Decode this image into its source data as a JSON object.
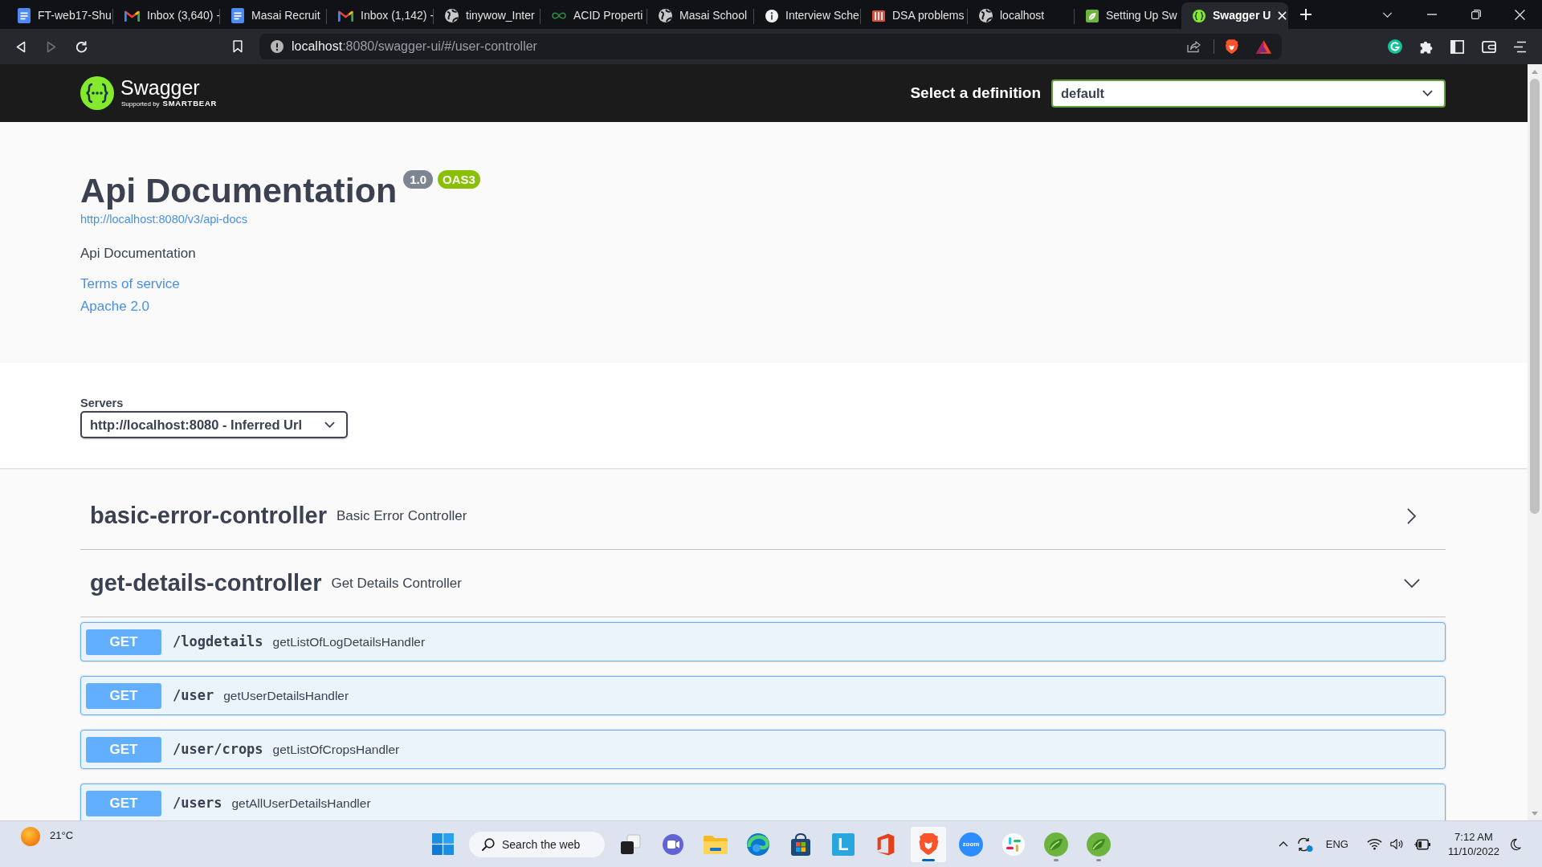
{
  "browser": {
    "tabs": [
      {
        "kind": "document",
        "title": "FT-web17-Shu",
        "selected": false
      },
      {
        "kind": "mail",
        "title": "Inbox (3,640) -",
        "selected": false
      },
      {
        "kind": "document",
        "title": "Masai Recruit",
        "selected": false
      },
      {
        "kind": "mail",
        "title": "Inbox (1,142) -",
        "selected": false
      },
      {
        "kind": "globe",
        "title": "tinywow_Inter",
        "selected": false
      },
      {
        "kind": "infinity",
        "title": "ACID Properti",
        "selected": false
      },
      {
        "kind": "globe",
        "title": "Masai School",
        "selected": false
      },
      {
        "kind": "info",
        "title": "Interview Sche",
        "selected": false
      },
      {
        "kind": "stripes",
        "title": "DSA problems",
        "selected": false
      },
      {
        "kind": "globe",
        "title": "localhost",
        "selected": false
      },
      {
        "kind": "leaf",
        "title": "Setting Up Sw",
        "selected": false
      },
      {
        "kind": "braces",
        "title": "Swagger U",
        "selected": true
      }
    ],
    "nav_buttons": [
      {
        "kind": "back",
        "disabled": false
      },
      {
        "kind": "forward",
        "disabled": true
      },
      {
        "kind": "reload",
        "disabled": false
      }
    ],
    "address_bar": {
      "host": "localhost",
      "path": ":8080/swagger-ui/#/user-controller"
    }
  },
  "swagger": {
    "header": {
      "logo_name": "Swagger",
      "logo_tagline": "Supported by",
      "logo_brand": "SMARTBEAR",
      "definition_label": "Select a definition",
      "definition_value": "default"
    },
    "info": {
      "title": "Api Documentation",
      "version": "1.0",
      "spec_version": "OAS3",
      "spec_url": "http://localhost:8080/v3/api-docs",
      "description": "Api Documentation",
      "links": [
        "Terms of service",
        "Apache 2.0"
      ]
    },
    "servers": {
      "label": "Servers",
      "selected_server": "http://localhost:8080 - Inferred Url"
    },
    "tags": [
      {
        "name": "basic-error-controller",
        "description": "Basic Error Controller",
        "expanded": false
      },
      {
        "name": "get-details-controller",
        "description": "Get Details Controller",
        "expanded": true,
        "operations": [
          {
            "method": "GET",
            "path": "/logdetails",
            "summary": "getListOfLogDetailsHandler"
          },
          {
            "method": "GET",
            "path": "/user",
            "summary": "getUserDetailsHandler"
          },
          {
            "method": "GET",
            "path": "/user/crops",
            "summary": "getListOfCropsHandler"
          },
          {
            "method": "GET",
            "path": "/users",
            "summary": "getAllUserDetailsHandler"
          }
        ]
      }
    ]
  },
  "taskbar": {
    "weather": "21°C",
    "search": {
      "placeholder": "Search the web"
    },
    "apps": [
      {
        "kind": "task-view",
        "selected": false,
        "running": false
      },
      {
        "kind": "chat",
        "selected": false,
        "running": false
      },
      {
        "kind": "folder",
        "selected": false,
        "running": false
      },
      {
        "kind": "swirl",
        "selected": false,
        "running": false
      },
      {
        "kind": "bag",
        "selected": false,
        "running": false
      },
      {
        "kind": "letter",
        "label": "L",
        "selected": false,
        "running": false
      },
      {
        "kind": "door",
        "selected": false,
        "running": false
      },
      {
        "kind": "shield",
        "selected": true,
        "running": true
      },
      {
        "kind": "video",
        "label": "zoom",
        "selected": false,
        "running": false
      },
      {
        "kind": "pinwheel",
        "selected": false,
        "running": false
      },
      {
        "kind": "leaf",
        "selected": false,
        "running": true
      },
      {
        "kind": "leaf",
        "selected": false,
        "running": true
      }
    ],
    "language": "ENG",
    "time": "7:12 AM",
    "date": "11/10/2022"
  }
}
